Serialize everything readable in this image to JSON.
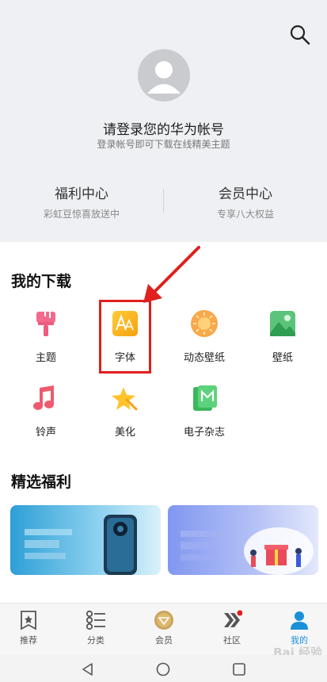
{
  "header": {
    "login_title": "请登录您的华为帐号",
    "login_subtitle": "登录帐号即可下载在线精美主题",
    "stats": [
      {
        "title": "福利中心",
        "subtitle": "彩虹豆惊喜放送中"
      },
      {
        "title": "会员中心",
        "subtitle": "专享八大权益"
      }
    ]
  },
  "downloads": {
    "title": "我的下载",
    "items": [
      {
        "label": "主题",
        "icon": "theme-brush-icon"
      },
      {
        "label": "字体",
        "icon": "font-icon"
      },
      {
        "label": "动态壁纸",
        "icon": "live-wallpaper-icon"
      },
      {
        "label": "壁纸",
        "icon": "wallpaper-icon"
      },
      {
        "label": "铃声",
        "icon": "ringtone-icon"
      },
      {
        "label": "美化",
        "icon": "beautify-star-icon"
      },
      {
        "label": "电子杂志",
        "icon": "magazine-icon"
      }
    ]
  },
  "benefits": {
    "title": "精选福利"
  },
  "tabbar": {
    "tabs": [
      {
        "label": "推荐",
        "icon": "recommend-icon"
      },
      {
        "label": "分类",
        "icon": "category-icon"
      },
      {
        "label": "会员",
        "icon": "vip-icon"
      },
      {
        "label": "社区",
        "icon": "community-icon"
      },
      {
        "label": "我的",
        "icon": "profile-icon",
        "active": true
      }
    ]
  },
  "watermark": "Bai 经验",
  "colors": {
    "accent": "#1a90d8",
    "highlight": "#e0201e",
    "header_bg": "#eef0f3"
  }
}
